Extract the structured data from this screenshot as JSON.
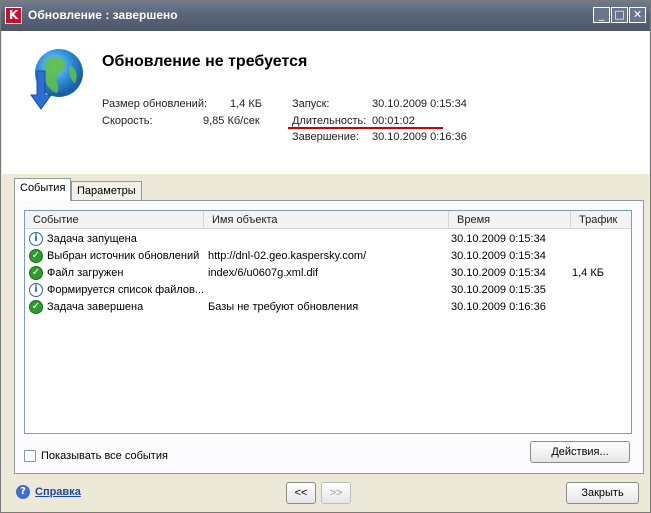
{
  "window": {
    "title": "Обновление : завершено",
    "app_icon_letter": "K",
    "buttons": {
      "minimize": "_",
      "maximize": "□",
      "close": "✕"
    }
  },
  "header": {
    "title": "Обновление не требуется",
    "stats": {
      "size_label": "Размер обновлений:",
      "size_value": "1,4 КБ",
      "speed_label": "Скорость:",
      "speed_value": "9,85 Кб/сек",
      "start_label": "Запуск:",
      "start_value": "30.10.2009 0:15:34",
      "duration_label": "Длительность:",
      "duration_value": "00:01:02",
      "end_label": "Завершение:",
      "end_value": "30.10.2009 0:16:36"
    }
  },
  "tabs": [
    {
      "label": "События",
      "active": true
    },
    {
      "label": "Параметры",
      "active": false
    }
  ],
  "events_table": {
    "columns": [
      "Событие",
      "Имя объекта",
      "Время",
      "Трафик"
    ],
    "rows": [
      {
        "icon": "info-icon",
        "event": "Задача запущена",
        "object": "",
        "time": "30.10.2009 0:15:34",
        "traffic": ""
      },
      {
        "icon": "check-icon",
        "event": "Выбран источник обновлений",
        "object": "http://dnl-02.geo.kaspersky.com/",
        "time": "30.10.2009 0:15:34",
        "traffic": ""
      },
      {
        "icon": "check-icon",
        "event": "Файл загружен",
        "object": "index/6/u0607g.xml.dif",
        "time": "30.10.2009 0:15:34",
        "traffic": "1,4 КБ"
      },
      {
        "icon": "info-icon",
        "event": "Формируется список файлов...",
        "object": "",
        "time": "30.10.2009 0:15:35",
        "traffic": ""
      },
      {
        "icon": "check-icon",
        "event": "Задача завершена",
        "object": "Базы не требуют обновления",
        "time": "30.10.2009 0:16:36",
        "traffic": ""
      }
    ]
  },
  "show_all_events": {
    "label": "Показывать все события",
    "checked": false
  },
  "actions_button": "Действия...",
  "footer": {
    "help_label": "Справка",
    "prev_label": "<<",
    "next_label": ">>",
    "close_label": "Закрыть"
  },
  "colors": {
    "accent_red": "#d40000",
    "title_bar": "#5a6579",
    "ok_green": "#2e9b2e",
    "info_blue": "#2f5fb3"
  }
}
